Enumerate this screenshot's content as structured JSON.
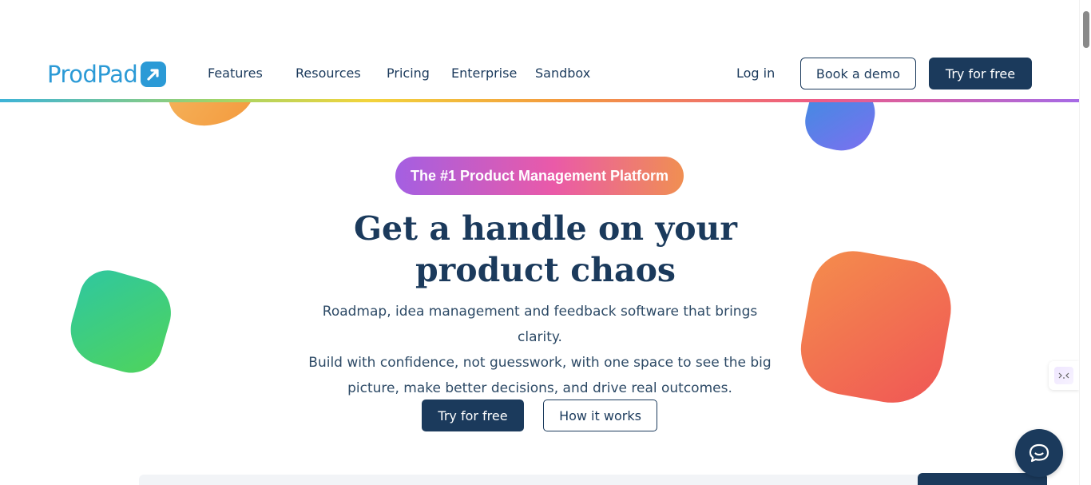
{
  "brand": {
    "name": "ProdPad",
    "primary_color": "#1b3a5c",
    "logo_color": "#2b9ad6"
  },
  "nav": {
    "features": "Features",
    "resources": "Resources",
    "pricing": "Pricing",
    "enterprise": "Enterprise",
    "sandbox": "Sandbox",
    "login": "Log in",
    "book_demo": "Book a demo",
    "try_free": "Try for free"
  },
  "hero": {
    "badge": "The #1 Product Management Platform",
    "headline_line1": "Get a handle on your",
    "headline_line2": "product chaos",
    "subtext_line1": "Roadmap, idea management and feedback software that brings clarity.",
    "subtext_line2": "Build with confidence, not guesswork, with one space to see the big",
    "subtext_line3": "picture, make better decisions, and drive real outcomes.",
    "cta_primary": "Try for free",
    "cta_secondary": "How it works"
  },
  "widgets": {
    "side_widget_icon": "chevron-code-icon",
    "chat_icon": "chat-bubble-icon"
  }
}
